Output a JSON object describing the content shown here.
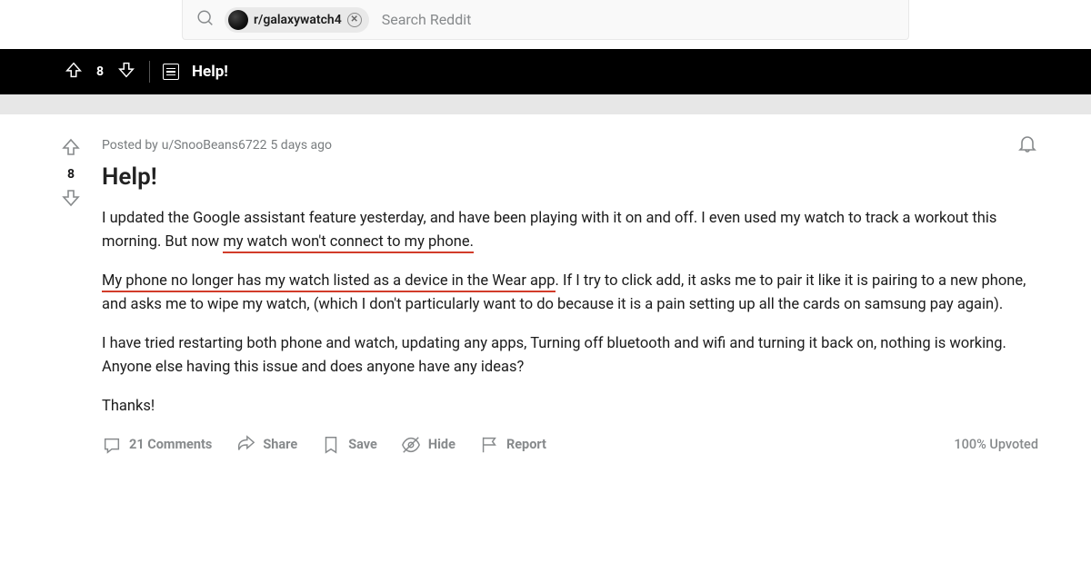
{
  "search": {
    "subreddit_chip": "r/galaxywatch4",
    "placeholder": "Search Reddit"
  },
  "sticky": {
    "score": "8",
    "title": "Help!"
  },
  "post": {
    "score": "8",
    "posted_by_prefix": "Posted by ",
    "author": "u/SnooBeans6722",
    "age": " 5 days ago",
    "title": "Help!",
    "para1_a": "I updated the Google assistant feature yesterday, and have been playing with it on and off. I even used my watch to track a workout this morning. But now ",
    "para1_ul": "my watch won't connect to my phone.",
    "para2_ul": "My phone no longer has my watch listed as a device in the Wear app",
    "para2_b": ". If I try to click add, it asks me to pair it like it is pairing to a new phone, and asks me to wipe my watch, (which I don't particularly want to do because it is a pain setting up all the cards on samsung pay again).",
    "para3": "I have tried restarting both phone and watch, updating any apps, Turning off bluetooth and wifi and turning it back on, nothing is working. Anyone else having this issue and does anyone have any ideas?",
    "para4": "Thanks!"
  },
  "actions": {
    "comments": "21 Comments",
    "share": "Share",
    "save": "Save",
    "hide": "Hide",
    "report": "Report",
    "upvoted": "100% Upvoted"
  }
}
